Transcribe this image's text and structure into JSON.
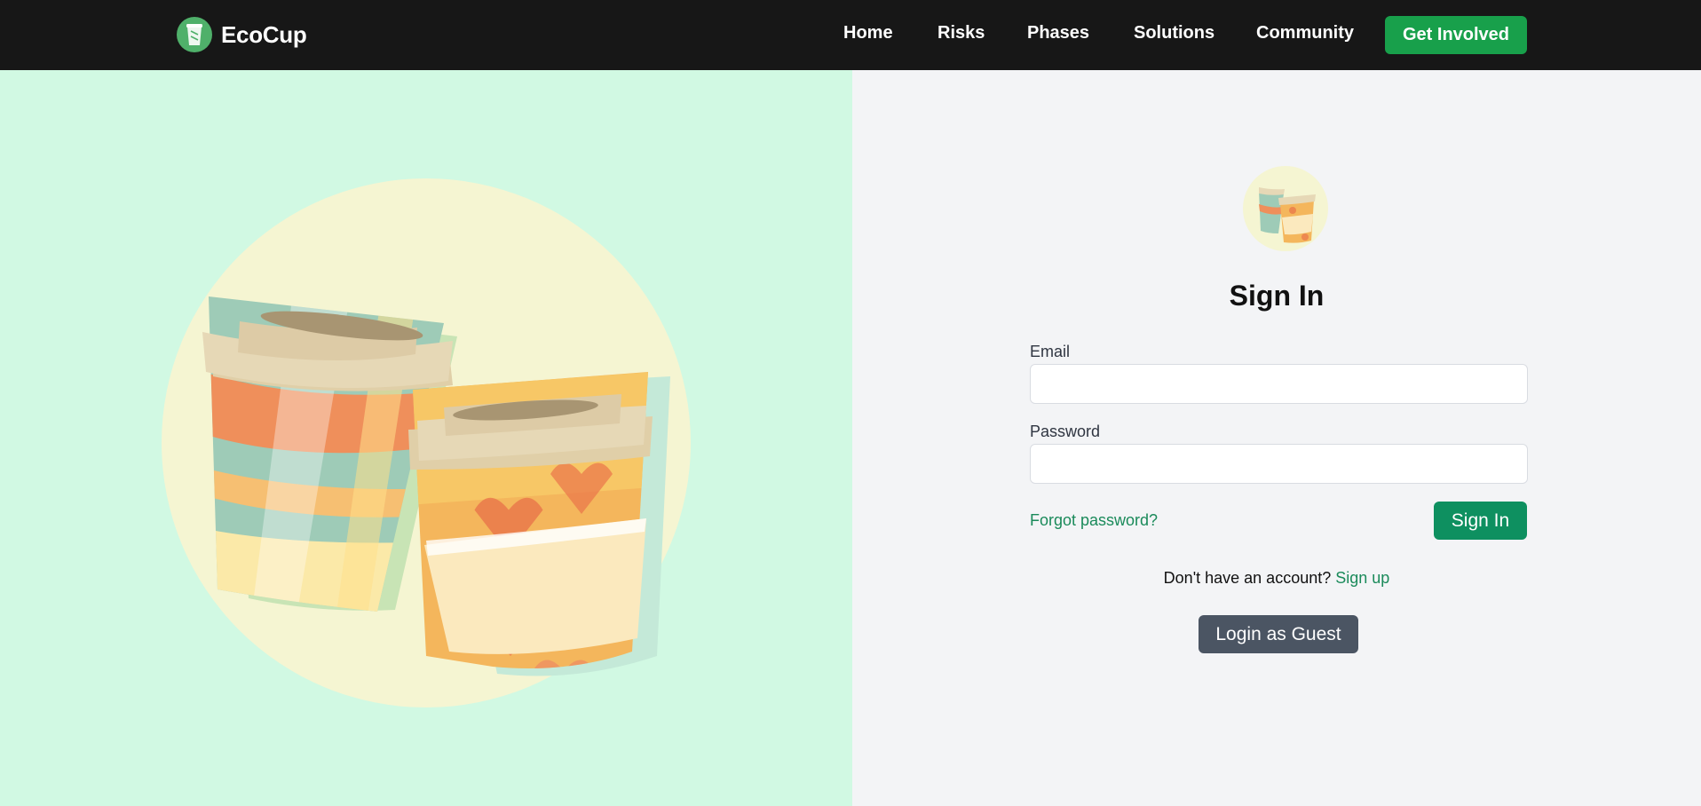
{
  "brand": {
    "name": "EcoCup",
    "logo_icon": "cup-icon"
  },
  "nav": {
    "links": [
      "Home",
      "Risks",
      "Phases",
      "Solutions",
      "Community"
    ],
    "cta": "Get Involved"
  },
  "colors": {
    "navbar_bg": "#171717",
    "brand_green": "#18a04b",
    "left_panel_bg": "#d1f9e3",
    "right_panel_bg": "#f3f4f6",
    "link_green": "#1a8a5a",
    "sign_in_button": "#0e9060",
    "guest_button": "#4b5563"
  },
  "illustration": {
    "name": "coffee-cups-illustration"
  },
  "form": {
    "title": "Sign In",
    "email_label": "Email",
    "email_value": "",
    "password_label": "Password",
    "password_value": "",
    "forgot_password": "Forgot password?",
    "submit": "Sign In",
    "no_account_text": "Don't have an account?",
    "signup_link": "Sign up",
    "guest_button": "Login as Guest"
  }
}
